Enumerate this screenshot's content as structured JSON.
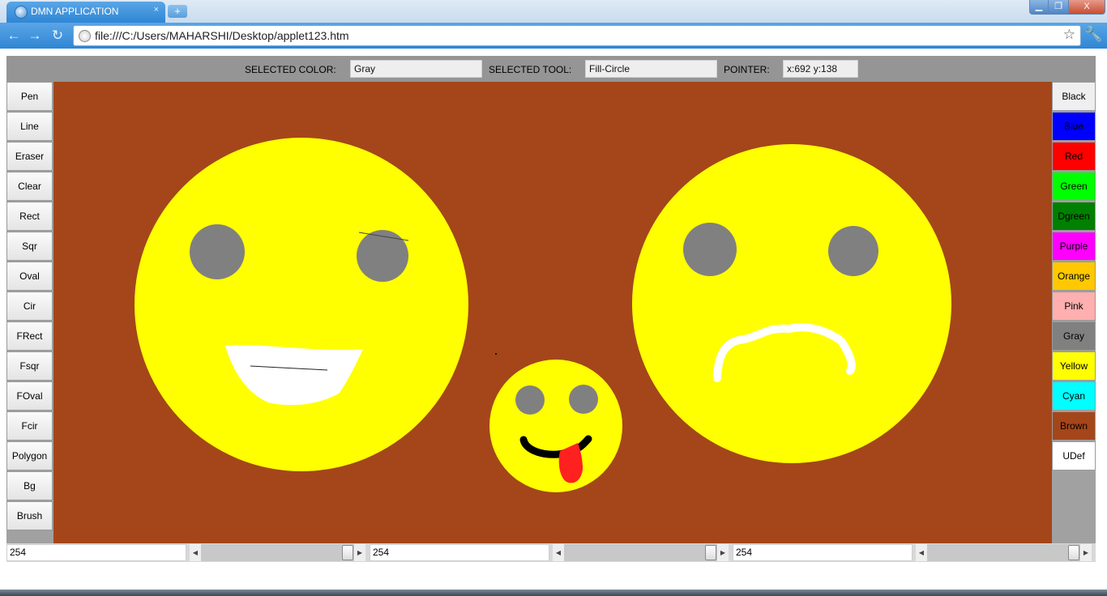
{
  "browser": {
    "tab_title": "DMN APPLICATION",
    "tab_close": "×",
    "new_tab": "+",
    "url": "file:///C:/Users/MAHARSHI/Desktop/applet123.htm",
    "window_controls": {
      "minimize": "▁",
      "maximize": "❐",
      "close": "X"
    }
  },
  "status": {
    "color_label": "SELECTED COLOR:",
    "color_value": "Gray",
    "tool_label": "SELECTED TOOL:",
    "tool_value": "Fill-Circle",
    "pointer_label": "POINTER:",
    "pointer_value": "x:692  y:138"
  },
  "tools": [
    "Pen",
    "Line",
    "Eraser",
    "Clear",
    "Rect",
    "Sqr",
    "Oval",
    "Cir",
    "FRect",
    "Fsqr",
    "FOval",
    "Fcir",
    "Polygon",
    "Bg",
    "Brush"
  ],
  "colors": [
    {
      "label": "Black",
      "bg": "#efefef"
    },
    {
      "label": "Blue",
      "bg": "#0000ff"
    },
    {
      "label": "Red",
      "bg": "#ff0000"
    },
    {
      "label": "Green",
      "bg": "#00ff00"
    },
    {
      "label": "Dgreen",
      "bg": "#008000"
    },
    {
      "label": "Purple",
      "bg": "#ff00ff"
    },
    {
      "label": "Orange",
      "bg": "#ffc800"
    },
    {
      "label": "Pink",
      "bg": "#ffafaf"
    },
    {
      "label": "Gray",
      "bg": "#808080"
    },
    {
      "label": "Yellow",
      "bg": "#ffff00"
    },
    {
      "label": "Cyan",
      "bg": "#00ffff"
    },
    {
      "label": "Brown",
      "bg": "#a4461a"
    },
    {
      "label": "UDef",
      "bg": "#ffffff"
    }
  ],
  "sliders": [
    {
      "value": "254",
      "level": 254,
      "max": 255
    },
    {
      "value": "254",
      "level": 254,
      "max": 255
    },
    {
      "value": "254",
      "level": 254,
      "max": 255
    }
  ],
  "canvas_colors": {
    "background": "#a4461a",
    "face": "#ffff00",
    "eyes": "#808080",
    "teeth": "#ffffff",
    "mouth": "#000000",
    "tongue": "#ff0000"
  }
}
